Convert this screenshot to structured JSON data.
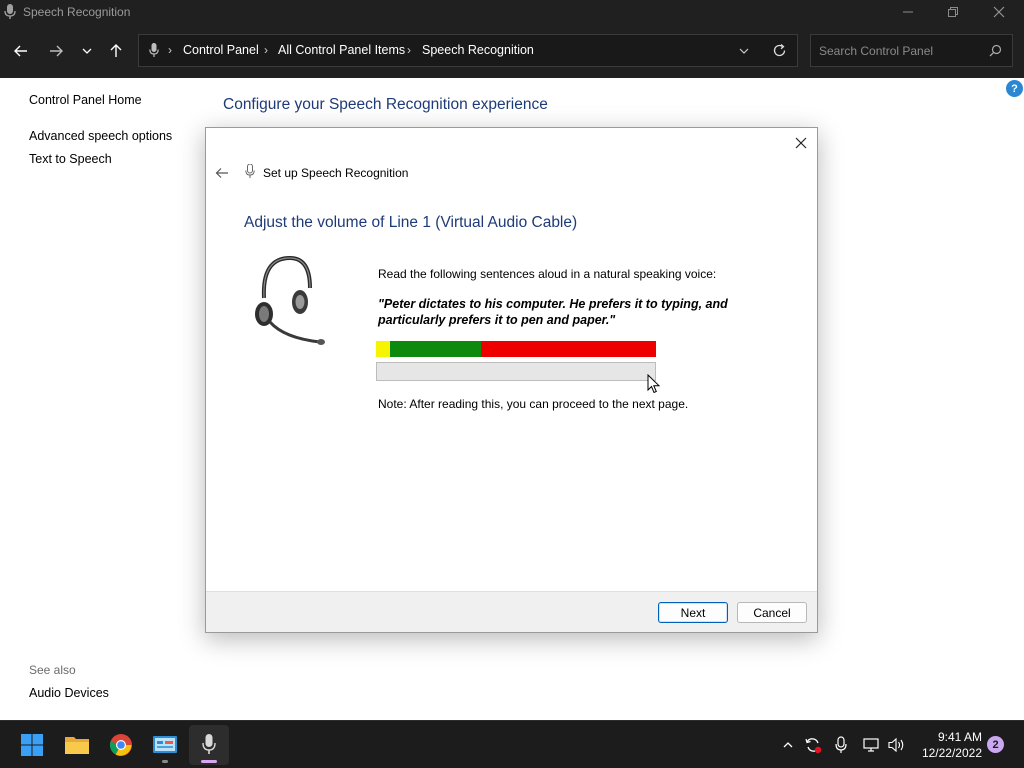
{
  "window": {
    "title": "Speech Recognition"
  },
  "breadcrumb": [
    {
      "label": "Control Panel"
    },
    {
      "label": "All Control Panel Items"
    },
    {
      "label": "Speech Recognition"
    }
  ],
  "search": {
    "placeholder": "Search Control Panel"
  },
  "sidebar": {
    "home": "Control Panel Home",
    "items": [
      {
        "label": "Advanced speech options"
      },
      {
        "label": "Text to Speech"
      }
    ],
    "see_also_heading": "See also",
    "see_also_items": [
      {
        "label": "Audio Devices"
      }
    ]
  },
  "main": {
    "heading": "Configure your Speech Recognition experience",
    "help_label": "?"
  },
  "dialog": {
    "title": "Set up Speech Recognition",
    "heading": "Adjust the volume of Line 1 (Virtual Audio Cable)",
    "instruction": "Read the following sentences aloud in a natural speaking voice:",
    "quote": "\"Peter dictates to his computer. He prefers it to typing, and particularly prefers it to pen and paper.\"",
    "level": 0,
    "note": "Note: After reading this, you can proceed to the next page.",
    "next_label": "Next",
    "cancel_label": "Cancel"
  },
  "taskbar": {
    "apps": [
      {
        "icon": "windows-start-icon"
      },
      {
        "icon": "file-explorer-icon"
      },
      {
        "icon": "chrome-icon"
      },
      {
        "icon": "control-panel-icon"
      },
      {
        "icon": "speech-recognition-icon"
      }
    ],
    "time": "9:41 AM",
    "date": "12/22/2022",
    "notifications": "2"
  },
  "colors": {
    "titlebar": "#202020",
    "heading_blue": "#1e3a78",
    "meter_yellow": "#f7f400",
    "meter_green": "#0d8a0d",
    "meter_red": "#ef0000",
    "primary_border": "#005fb8"
  }
}
